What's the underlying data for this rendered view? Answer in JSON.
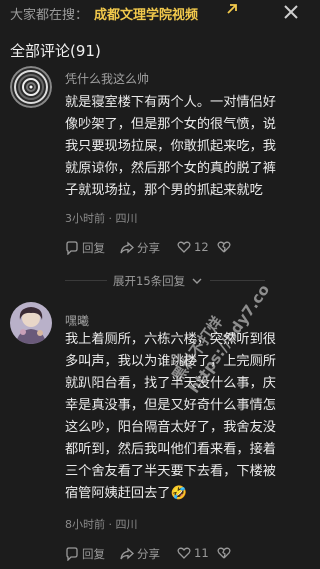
{
  "header": {
    "search_hint": "大家都在搜：",
    "search_term": "成都文理学院视频",
    "close_icon": "close-icon"
  },
  "comments_title": "全部评论(91)",
  "comments": [
    {
      "username": "凭什么我这么帅",
      "lines": [
        "就是寝室楼下有两个人。一对情侣好",
        "像吵架了，但是那个女的很气愤，说",
        "我只要现场拉屎，你敢抓起来吃，我",
        "就原谅你，然后那个女的真的脱了裤",
        "子就现场拉，那个男的抓起来就吃"
      ],
      "meta": "3小时前 · 四川",
      "reply_label": "回复",
      "share_label": "分享",
      "like_count": "12"
    },
    {
      "username": "嘿曦",
      "lines": [
        "我上着厕所，六栋六楼，突然听到很",
        "多叫声，我以为谁跳楼了，上完厕所",
        "就趴阳台看，找了半天没什么事，庆",
        "幸是真没事，但是又好奇什么事情怎",
        "这么吵，阳台隔音太好了，我舍友没",
        "都听到，然后我叫他们看来看，接着",
        "三个舍友看了半天要下去看，下楼被",
        "宿管阿姨赶回去了🤣"
      ],
      "meta": "8小时前 · 四川",
      "reply_label": "回复",
      "share_label": "分享",
      "like_count": "11"
    }
  ],
  "expand_label": "展开15条回复",
  "watermark": {
    "line1": "黑料不打烊",
    "line2": "https://bdy7.co"
  }
}
